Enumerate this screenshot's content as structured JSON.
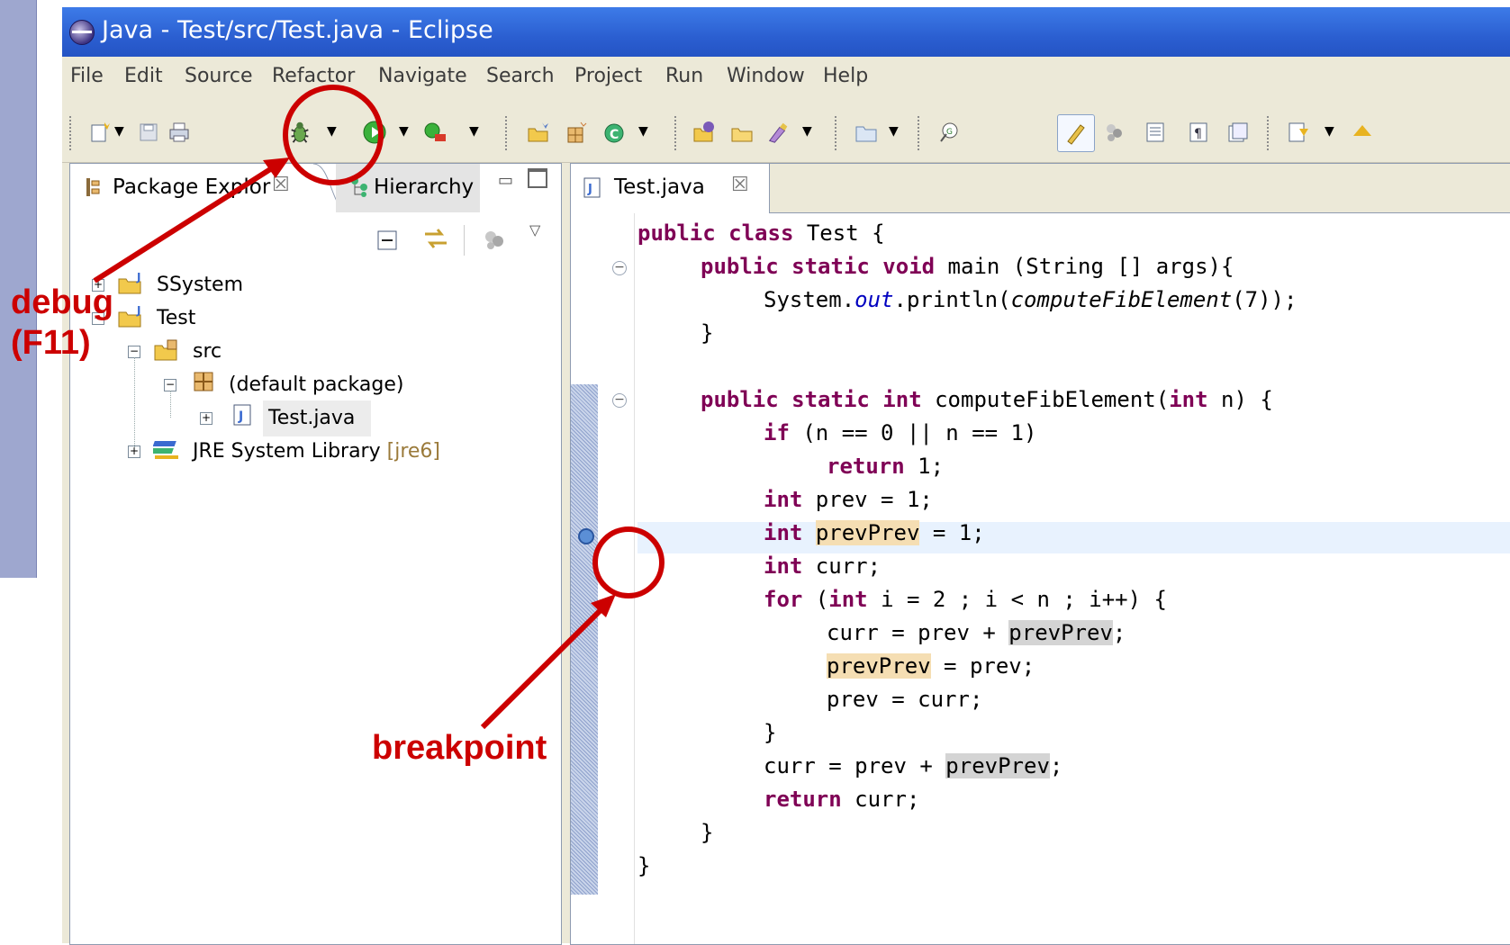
{
  "window": {
    "title": "Java - Test/src/Test.java - Eclipse",
    "menus": [
      "File",
      "Edit",
      "Source",
      "Refactor",
      "Navigate",
      "Search",
      "Project",
      "Run",
      "Window",
      "Help"
    ]
  },
  "left_panel": {
    "tab_package_explorer": "Package Explor",
    "tab_hierarchy": "Hierarchy",
    "tree": {
      "project_ssystem": "SSystem",
      "project_test": "Test",
      "folder_src": "src",
      "default_package": "(default package)",
      "file_test_java": "Test.java",
      "jre_library": "JRE System Library",
      "jre_version": "[jre6]"
    }
  },
  "editor": {
    "tab_label": "Test.java",
    "code": {
      "l1_kw": "public class",
      "l1_rest": " Test {",
      "l2_kw": "public static void",
      "l2_rest": " main (String [] args){",
      "l3_a": "System.",
      "l3_field": "out",
      "l3_b": ".println(",
      "l3_call": "computeFibElement",
      "l3_c": "(7));",
      "l4": "}",
      "l5_kw": "public static int",
      "l5_a": " computeFibElement(",
      "l5_kw2": "int",
      "l5_b": " n) {",
      "l6_kw": "if",
      "l6_rest": " (n == 0 || n == 1)",
      "l7_kw": "return",
      "l7_rest": " 1;",
      "l8_kw": "int",
      "l8_rest": " prev = 1;",
      "l9_kw": "int",
      "l9_var": "prevPrev",
      "l9_rest": " = 1;",
      "l10_kw": "int",
      "l10_rest": " curr;",
      "l11_kw": "for",
      "l11_a": " (",
      "l11_kw2": "int",
      "l11_b": " i = 2 ; i < n ; i++) {",
      "l12_a": "curr = prev + ",
      "l12_var": "prevPrev",
      "l12_b": ";",
      "l13_var": "prevPrev",
      "l13_rest": " = prev;",
      "l14": "prev = curr;",
      "l15": "}",
      "l16_a": "curr = prev + ",
      "l16_var": "prevPrev",
      "l16_b": ";",
      "l17_kw": "return",
      "l17_rest": " curr;",
      "l18": "}",
      "l19": "}"
    }
  },
  "annotations": {
    "debug_line1": "debug",
    "debug_line2": "(F11)",
    "breakpoint": "breakpoint",
    "color": "#cc0000"
  },
  "icons": [
    "eclipse-icon",
    "new-icon",
    "save-icon",
    "print-icon",
    "debug-bug-icon",
    "run-icon",
    "external-tools-icon",
    "new-project-icon",
    "new-package-icon",
    "new-class-icon",
    "open-type-icon",
    "open-task-icon",
    "search-icon",
    "folder-icon",
    "mark-occurrences-icon",
    "collapse-all-icon",
    "link-editor-icon",
    "view-menu-icon",
    "breakpoint-icon"
  ]
}
